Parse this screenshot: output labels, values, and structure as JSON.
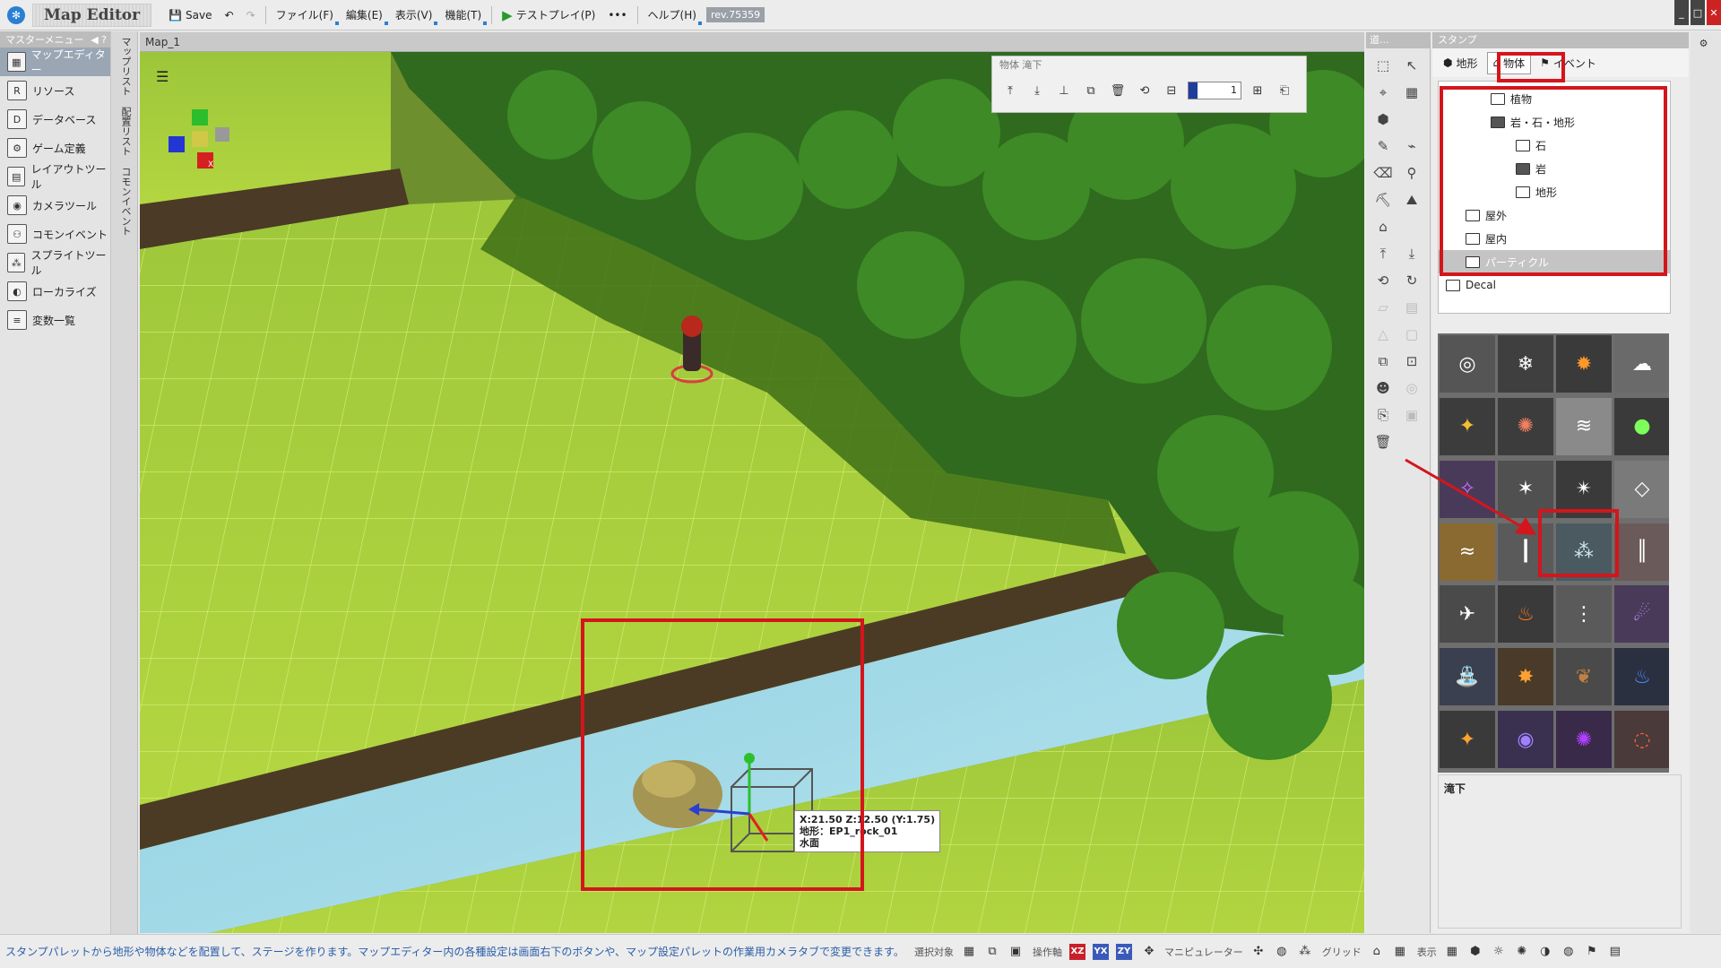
{
  "app": {
    "title": "Map Editor",
    "save": "Save",
    "rev": "rev.75359"
  },
  "menus": [
    "ファイル(F)",
    "編集(E)",
    "表示(V)",
    "機能(T)",
    "テストプレイ(P)",
    "ヘルプ(H)"
  ],
  "left_menu": {
    "header": "マスターメニュー",
    "items": [
      "マップエディター",
      "リソース",
      "データベース",
      "ゲーム定義",
      "レイアウトツール",
      "カメラツール",
      "コモンイベント",
      "スプライトツール",
      "ローカライズ",
      "変数一覧"
    ]
  },
  "vtabs": [
    "マップリスト",
    "配置リスト",
    "コモンイベント"
  ],
  "viewport": {
    "tab": "Map_1",
    "float_toolbar_title": "物体 滝下",
    "slider_value": "1",
    "coord_tip": [
      "X:21.50 Z:12.50 (Y:1.75)",
      "地形：EP1_rock_01",
      "水面"
    ],
    "axis_label": "X"
  },
  "tool_col": {
    "header": "道..."
  },
  "stamp": {
    "header": "スタンプ",
    "tabs": [
      "地形",
      "物体",
      "イベント"
    ],
    "tree": [
      {
        "label": "植物",
        "level": 2,
        "open": false
      },
      {
        "label": "岩・石・地形",
        "level": 2,
        "open": true
      },
      {
        "label": "石",
        "level": 3,
        "open": false
      },
      {
        "label": "岩",
        "level": 3,
        "open": true
      },
      {
        "label": "地形",
        "level": 3,
        "open": false
      },
      {
        "label": "屋外",
        "level": 1,
        "open": false
      },
      {
        "label": "屋内",
        "level": 1,
        "open": false
      },
      {
        "label": "パーティクル",
        "level": 1,
        "open": false,
        "selected": true
      },
      {
        "label": "Decal",
        "level": 0,
        "open": false
      }
    ],
    "selected_name": "滝下"
  },
  "statusbar": {
    "message": "スタンプパレットから地形や物体などを配置して、ステージを作ります。マップエディター内の各種設定は画面右下のボタンや、マップ設定パレットの作業用カメラタブで変更できます。",
    "select_target": "選択対象",
    "op_axis": "操作軸",
    "axes": [
      "XZ",
      "YX",
      "ZY"
    ],
    "manipulator": "マニピュレーター",
    "grid": "グリッド",
    "display": "表示"
  }
}
